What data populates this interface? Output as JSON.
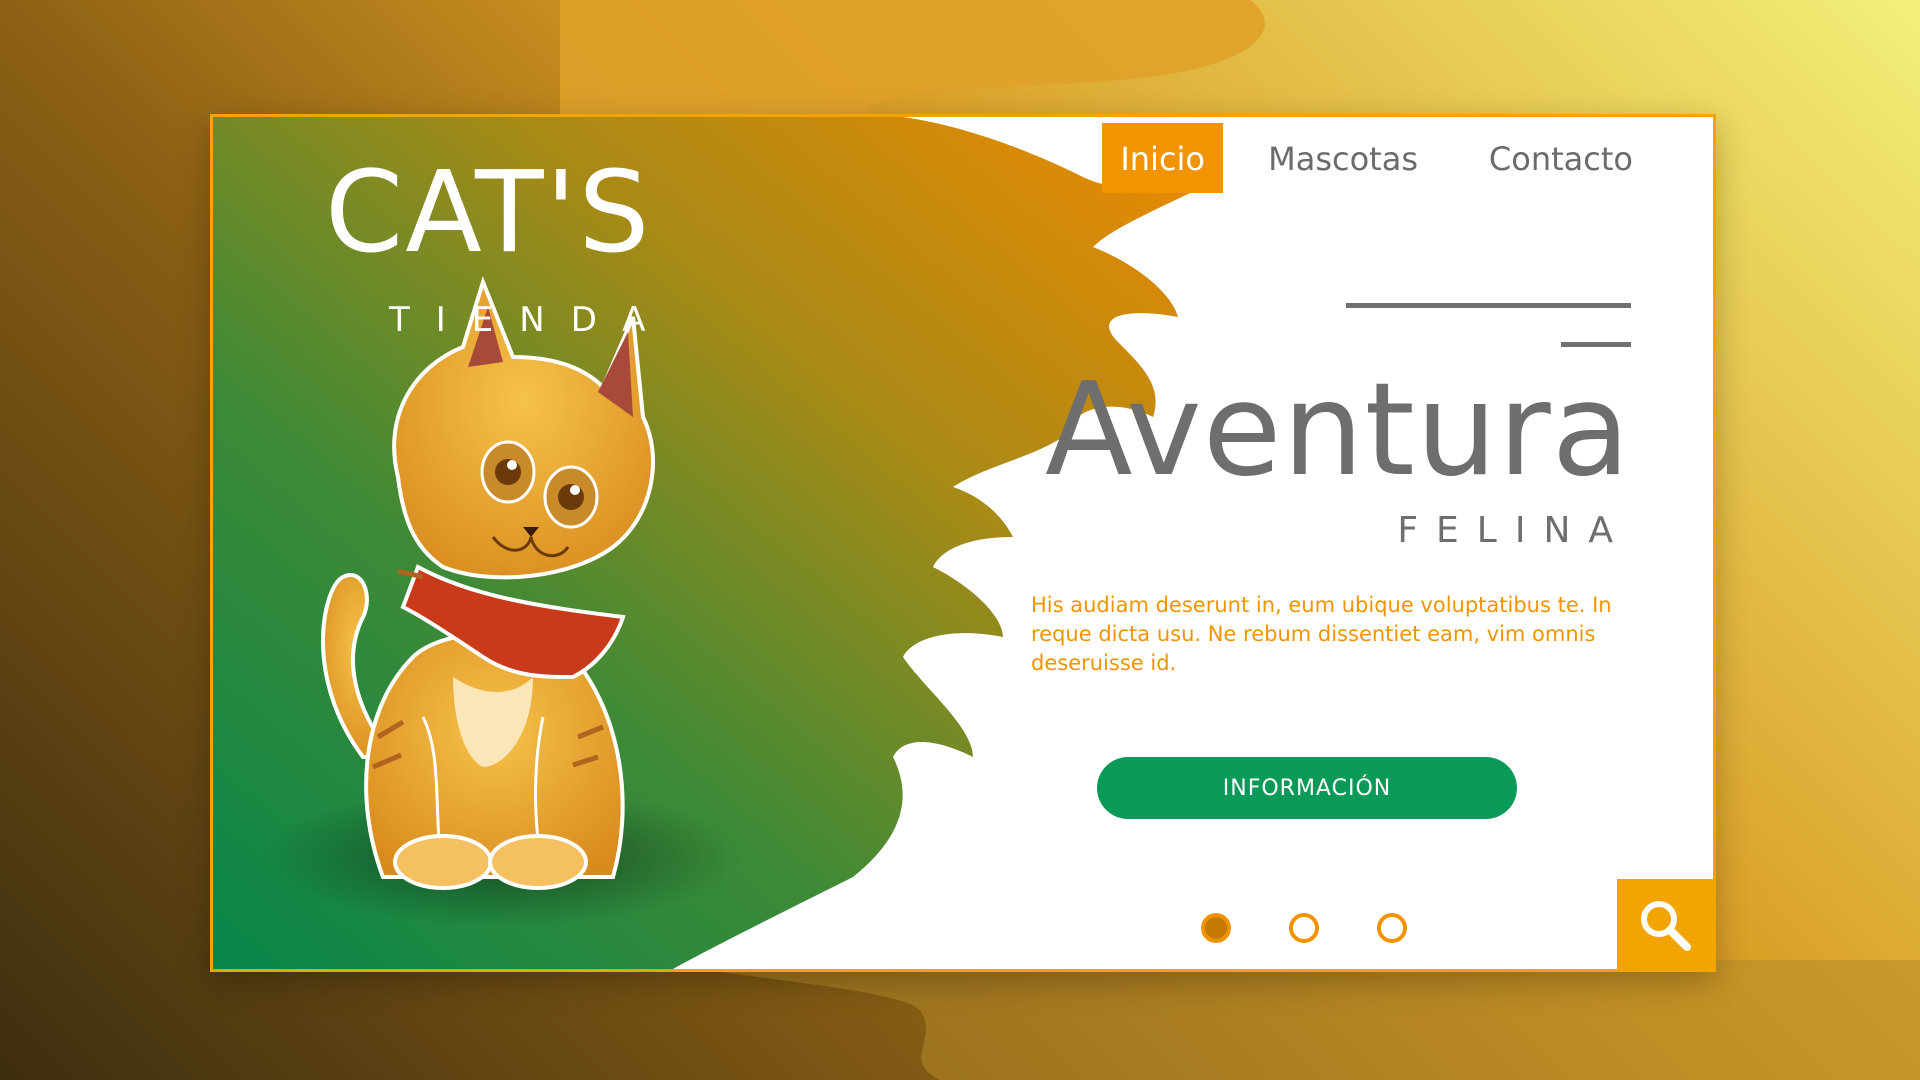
{
  "brand": {
    "title": "CAT'S",
    "subtitle": "TIENDA"
  },
  "nav": {
    "items": [
      {
        "label": "Inicio",
        "active": true
      },
      {
        "label": "Mascotas",
        "active": false
      },
      {
        "label": "Contacto",
        "active": false
      }
    ]
  },
  "hero": {
    "title": "Aventura",
    "subtitle": "FELINA",
    "body": "His audiam deserunt in, eum ubique voluptatibus te. In reque dicta usu. Ne rebum dissentiet eam, vim omnis deseruisse id.",
    "button_label": "INFORMACIÓN"
  },
  "carousel": {
    "slide_count": 3,
    "active_index": 0
  },
  "icons": {
    "search": "search-icon",
    "mascot": "cat-illustration"
  },
  "colors": {
    "accent_orange": "#f29400",
    "button_green": "#0a9a57",
    "panel_green": "#0a8a4a",
    "text_gray": "#6e6e6e"
  }
}
